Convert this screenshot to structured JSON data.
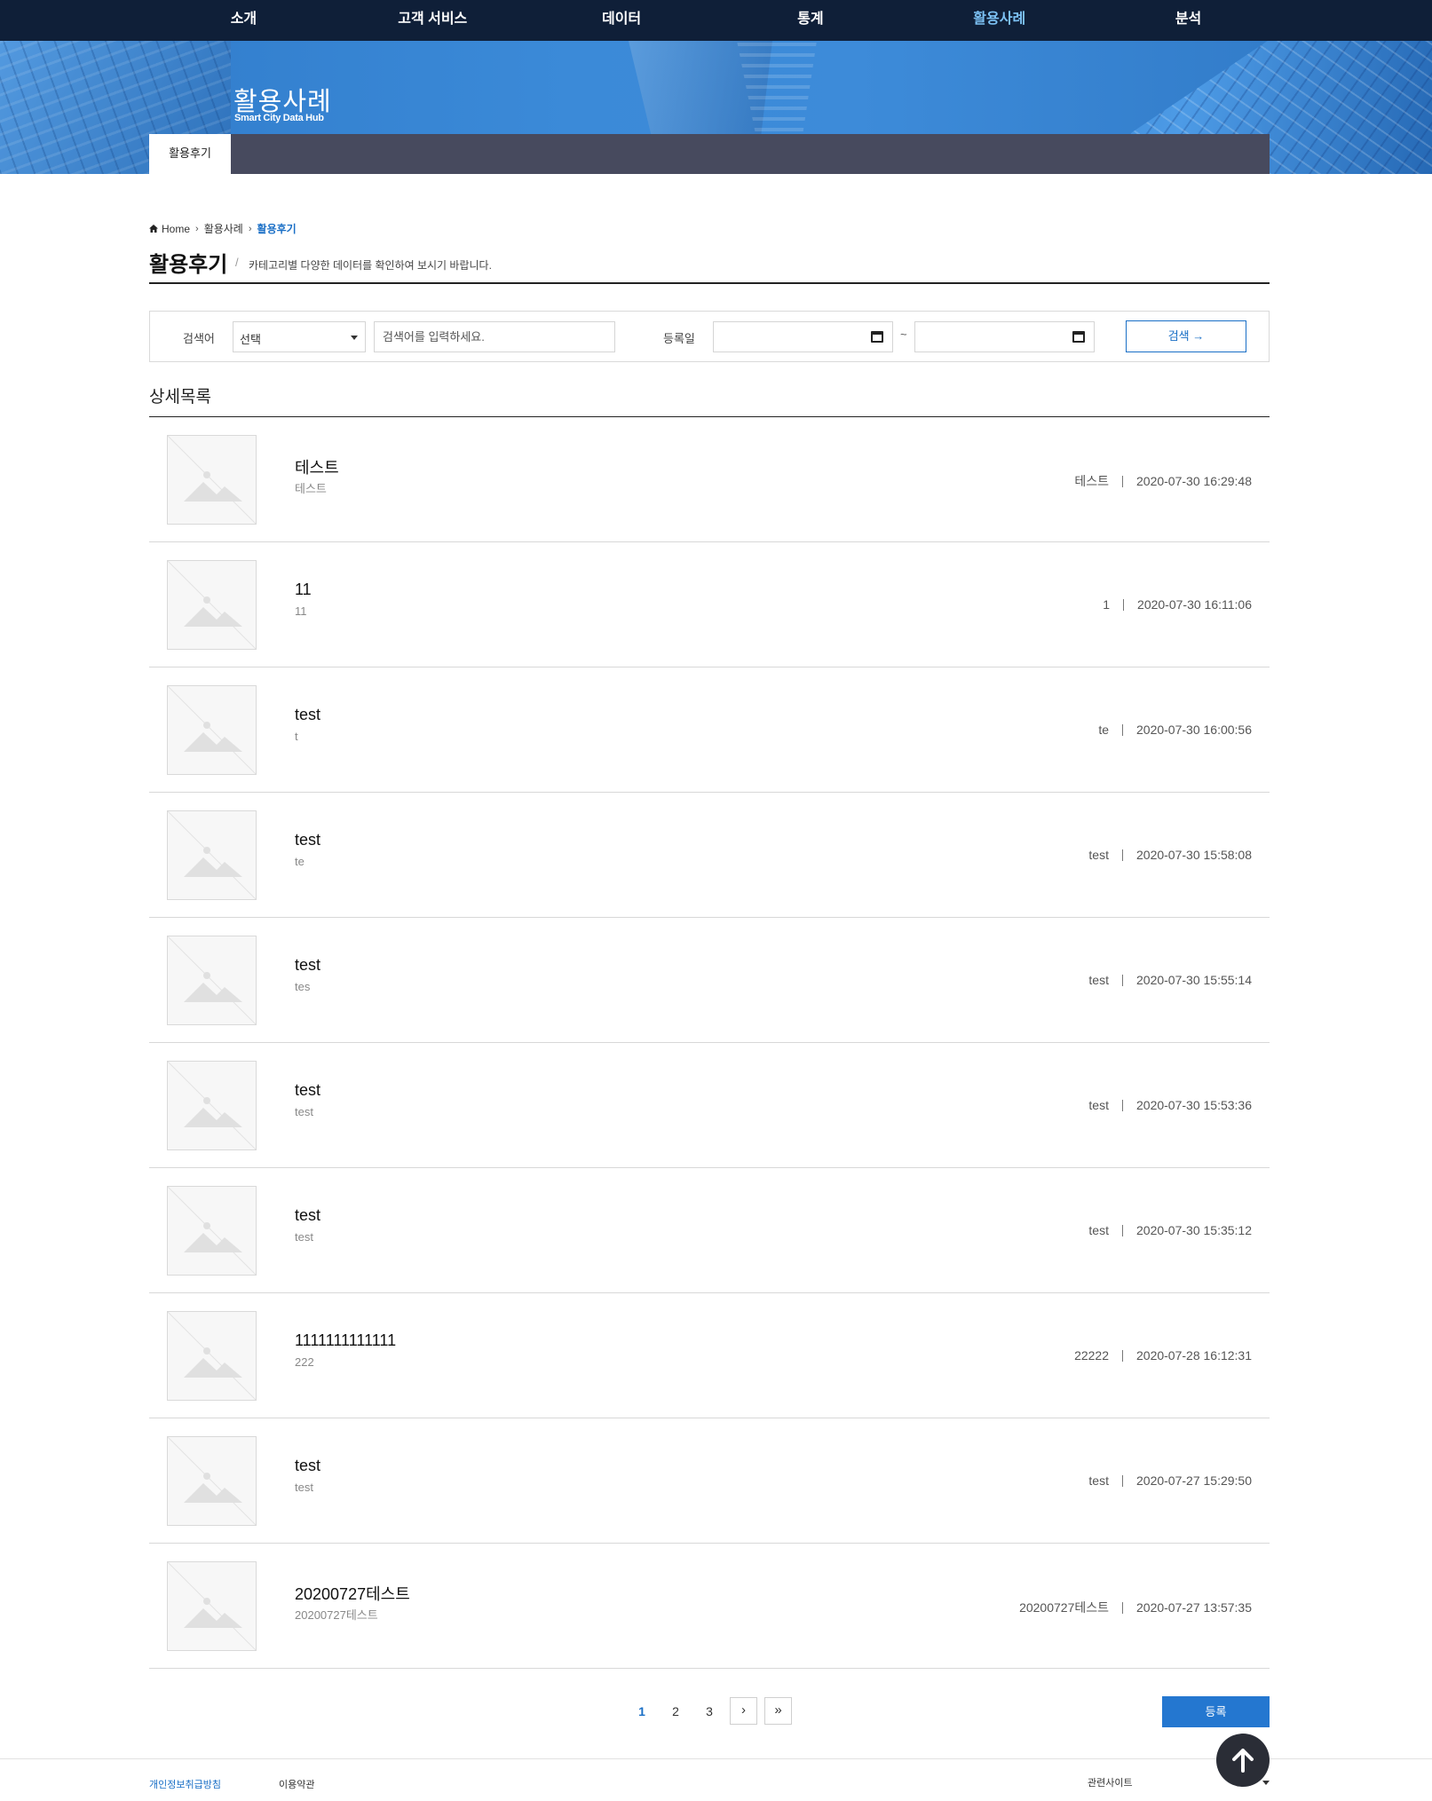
{
  "nav": {
    "items": [
      {
        "label": "소개"
      },
      {
        "label": "고객 서비스"
      },
      {
        "label": "데이터"
      },
      {
        "label": "통계"
      },
      {
        "label": "활용사례"
      },
      {
        "label": "분석"
      }
    ],
    "active_index": 4
  },
  "hero": {
    "title": "활용사례",
    "subtitle": "Smart City Data Hub",
    "tab": "활용후기"
  },
  "breadcrumb": {
    "home": "Home",
    "section": "활용사례",
    "current": "활용후기"
  },
  "page": {
    "title": "활용후기",
    "description": "카테고리별 다양한 데이터를 확인하여 보시기 바랍니다."
  },
  "search": {
    "keyword_label": "검색어",
    "select_value": "선택",
    "keyword_placeholder": "검색어를 입력하세요.",
    "date_label": "등록일",
    "date_separator": "~",
    "button_label": "검색 →"
  },
  "list": {
    "title": "상세목록",
    "items": [
      {
        "title": "테스트",
        "summary": "테스트",
        "author": "테스트",
        "date": "2020-07-30 16:29:48"
      },
      {
        "title": "11",
        "summary": "11",
        "author": "1",
        "date": "2020-07-30 16:11:06"
      },
      {
        "title": "test",
        "summary": "t",
        "author": "te",
        "date": "2020-07-30 16:00:56"
      },
      {
        "title": "test",
        "summary": "te",
        "author": "test",
        "date": "2020-07-30 15:58:08"
      },
      {
        "title": "test",
        "summary": "tes",
        "author": "test",
        "date": "2020-07-30 15:55:14"
      },
      {
        "title": "test",
        "summary": "test",
        "author": "test",
        "date": "2020-07-30 15:53:36"
      },
      {
        "title": "test",
        "summary": "test",
        "author": "test",
        "date": "2020-07-30 15:35:12"
      },
      {
        "title": "1111111111111",
        "summary": "222",
        "author": "22222",
        "date": "2020-07-28 16:12:31"
      },
      {
        "title": "test",
        "summary": "test",
        "author": "test",
        "date": "2020-07-27 15:29:50"
      },
      {
        "title": "20200727테스트",
        "summary": "20200727테스트",
        "author": "20200727테스트",
        "date": "2020-07-27 13:57:35"
      }
    ]
  },
  "pagination": {
    "pages": [
      "1",
      "2",
      "3"
    ],
    "current": "1",
    "next": "›",
    "last": "»"
  },
  "register_button": "등록",
  "footer": {
    "privacy": "개인정보취급방침",
    "terms": "이용약관",
    "related": "관련사이트"
  },
  "colors": {
    "nav_bg": "#0f1f38",
    "nav_active": "#7cc1f4",
    "accent": "#1a6fc6",
    "tabbar": "#474a5e"
  }
}
